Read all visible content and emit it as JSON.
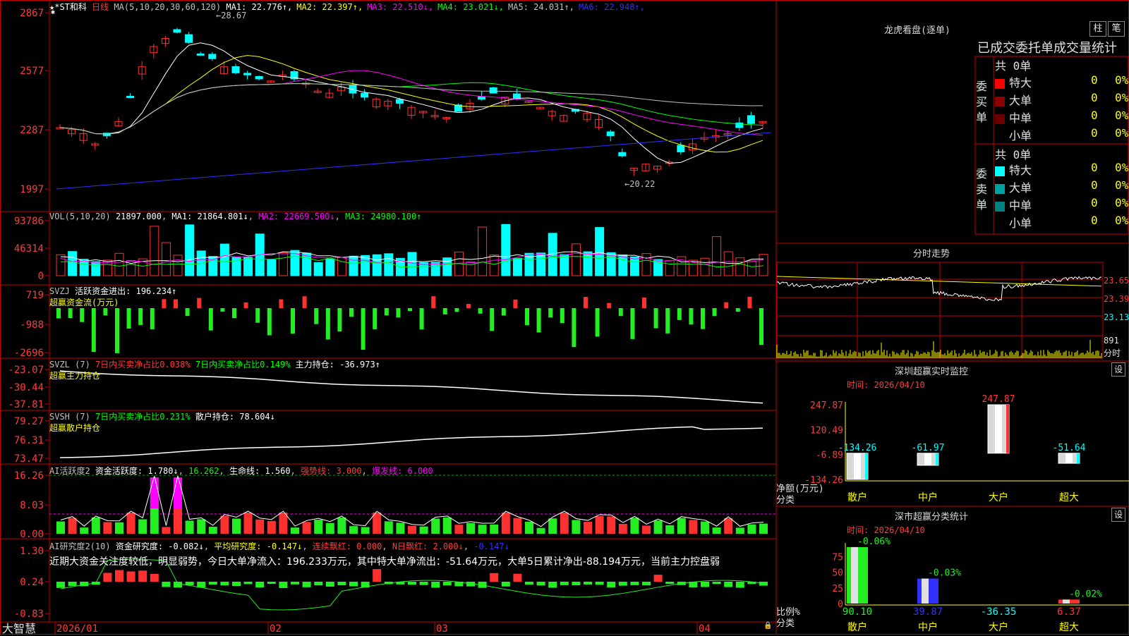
{
  "header": {
    "stock": "★*ST和科",
    "period": "日线",
    "ma_label": "MA(5,10,20,30,60,120)",
    "ma": [
      {
        "name": "MA1",
        "value": "22.776",
        "arrow": "↑",
        "color": "#ffffff"
      },
      {
        "name": "MA2",
        "value": "22.397",
        "arrow": "↑",
        "color": "#ffff00"
      },
      {
        "name": "MA3",
        "value": "22.510",
        "arrow": "↓",
        "color": "#ff00ff"
      },
      {
        "name": "MA4",
        "value": "23.021",
        "arrow": "↓",
        "color": "#00ff00"
      },
      {
        "name": "MA5",
        "value": "24.031",
        "arrow": "↑",
        "color": "#c0c0c0"
      },
      {
        "name": "MA6",
        "value": "22.948",
        "arrow": "↑",
        "color": "#3030ff"
      }
    ],
    "high_mark": "28.67",
    "low_mark": "←20.22"
  },
  "main_axis": [
    "2867",
    "2577",
    "2287",
    "1997"
  ],
  "vol": {
    "label": "VOL(5,10,20)",
    "value": "21897.000",
    "ma1": "MA1: 21864.801↓",
    "ma2": "MA2: 22669.500↓",
    "ma3": "MA3: 24980.100↑",
    "axis": [
      "93786",
      "46314",
      "0"
    ]
  },
  "svzj": {
    "label": "SVZJ",
    "text1": "活跃资金进出: 196.234↑",
    "text2": "超赢资金流(万元)",
    "axis": [
      "719",
      "-988",
      "-2696"
    ]
  },
  "svzl": {
    "label": "SVZL (7)",
    "t1": "7日内买卖净占比0.038%",
    "t2": "7日内买卖净占比0.149%",
    "t3": "主力持仓: -36.973↑",
    "sub": "超赢主力持仓",
    "axis": [
      "-23.07",
      "-30.44",
      "-37.81"
    ]
  },
  "svsh": {
    "label": "SVSH (7)",
    "t1": "7日内买卖净占比0.231%",
    "t2": "散户持仓: 78.604↓",
    "sub": "超赢散户持仓",
    "axis": [
      "79.27",
      "76.31",
      "73.47"
    ]
  },
  "ai1": {
    "label": "AI活跃度2",
    "t1": "资金活跃度: 1.780↓",
    "t2": "16.262",
    "t3": "生命线: 1.560",
    "t4": "强势线: 3.000",
    "t5": "爆发线: 6.000",
    "axis": [
      "16.26",
      "8.03",
      "0.00"
    ]
  },
  "ai2": {
    "label": "AI研究度2(10)",
    "t1": "资金研究度: -0.082↓",
    "t2": "平均研究度: -0.147↓",
    "t3": "连续飘红: 0.000",
    "t4": "N日飘红: 2.000↓",
    "t5": "-0.147↓",
    "comment": "近期大资金关注度较低，明显弱势，今日大单净流入：196.233万元，其中特大单净流出：-51.64万元，大单5日累计净出-88.194万元，当前主力控盘弱",
    "axis": [
      "1.30",
      "0.24",
      "-0.83"
    ]
  },
  "bottom": {
    "brand": "大智慧",
    "dates": [
      "2026/01",
      "02",
      "03",
      "04"
    ]
  },
  "right_top": {
    "title": "龙虎看盘(逐单)",
    "btn1": "柱",
    "btn2": "笔",
    "subtitle": "已成交委托单成交量统计",
    "buy_label": "委买单",
    "sell_label": "委卖单",
    "buy_total": "共 0单",
    "sell_total": "共 0单",
    "rows": [
      {
        "name": "特大",
        "count": "0",
        "pct": "0%"
      },
      {
        "name": "大单",
        "count": "0",
        "pct": "0%"
      },
      {
        "name": "中单",
        "count": "0",
        "pct": "0%"
      },
      {
        "name": "小单",
        "count": "0",
        "pct": "0%"
      }
    ]
  },
  "intraday": {
    "title": "分时走势",
    "axis": [
      "23.65",
      "23.39",
      "23.13"
    ],
    "vol_label": "891",
    "vol_unit": "分时"
  },
  "monitor": {
    "title": "深圳超赢实时监控",
    "btn": "设",
    "time": "时间: 2026/04/10",
    "axis": [
      "247.87",
      "120.49",
      "-6.89",
      "-134.26"
    ],
    "ylabel": "净额(万元)",
    "xlabel": "分类",
    "cats": [
      "散户",
      "中户",
      "大户",
      "超大"
    ],
    "values": [
      "-134.26",
      "-61.97",
      "247.87",
      "-51.64"
    ]
  },
  "stats": {
    "title": "深市超赢分类统计",
    "btn": "设",
    "time": "时间: 2026/04/10",
    "axis": [
      "75",
      "50",
      "25",
      "0"
    ],
    "ylabel": "比例%",
    "xlabel": "分类",
    "cats": [
      "散户",
      "中户",
      "大户",
      "超大"
    ],
    "top": [
      "-0.06%",
      "-0.03%",
      "",
      "-0.02%"
    ],
    "values": [
      "90.10",
      "39.87",
      "-36.35",
      "6.37"
    ]
  }
}
